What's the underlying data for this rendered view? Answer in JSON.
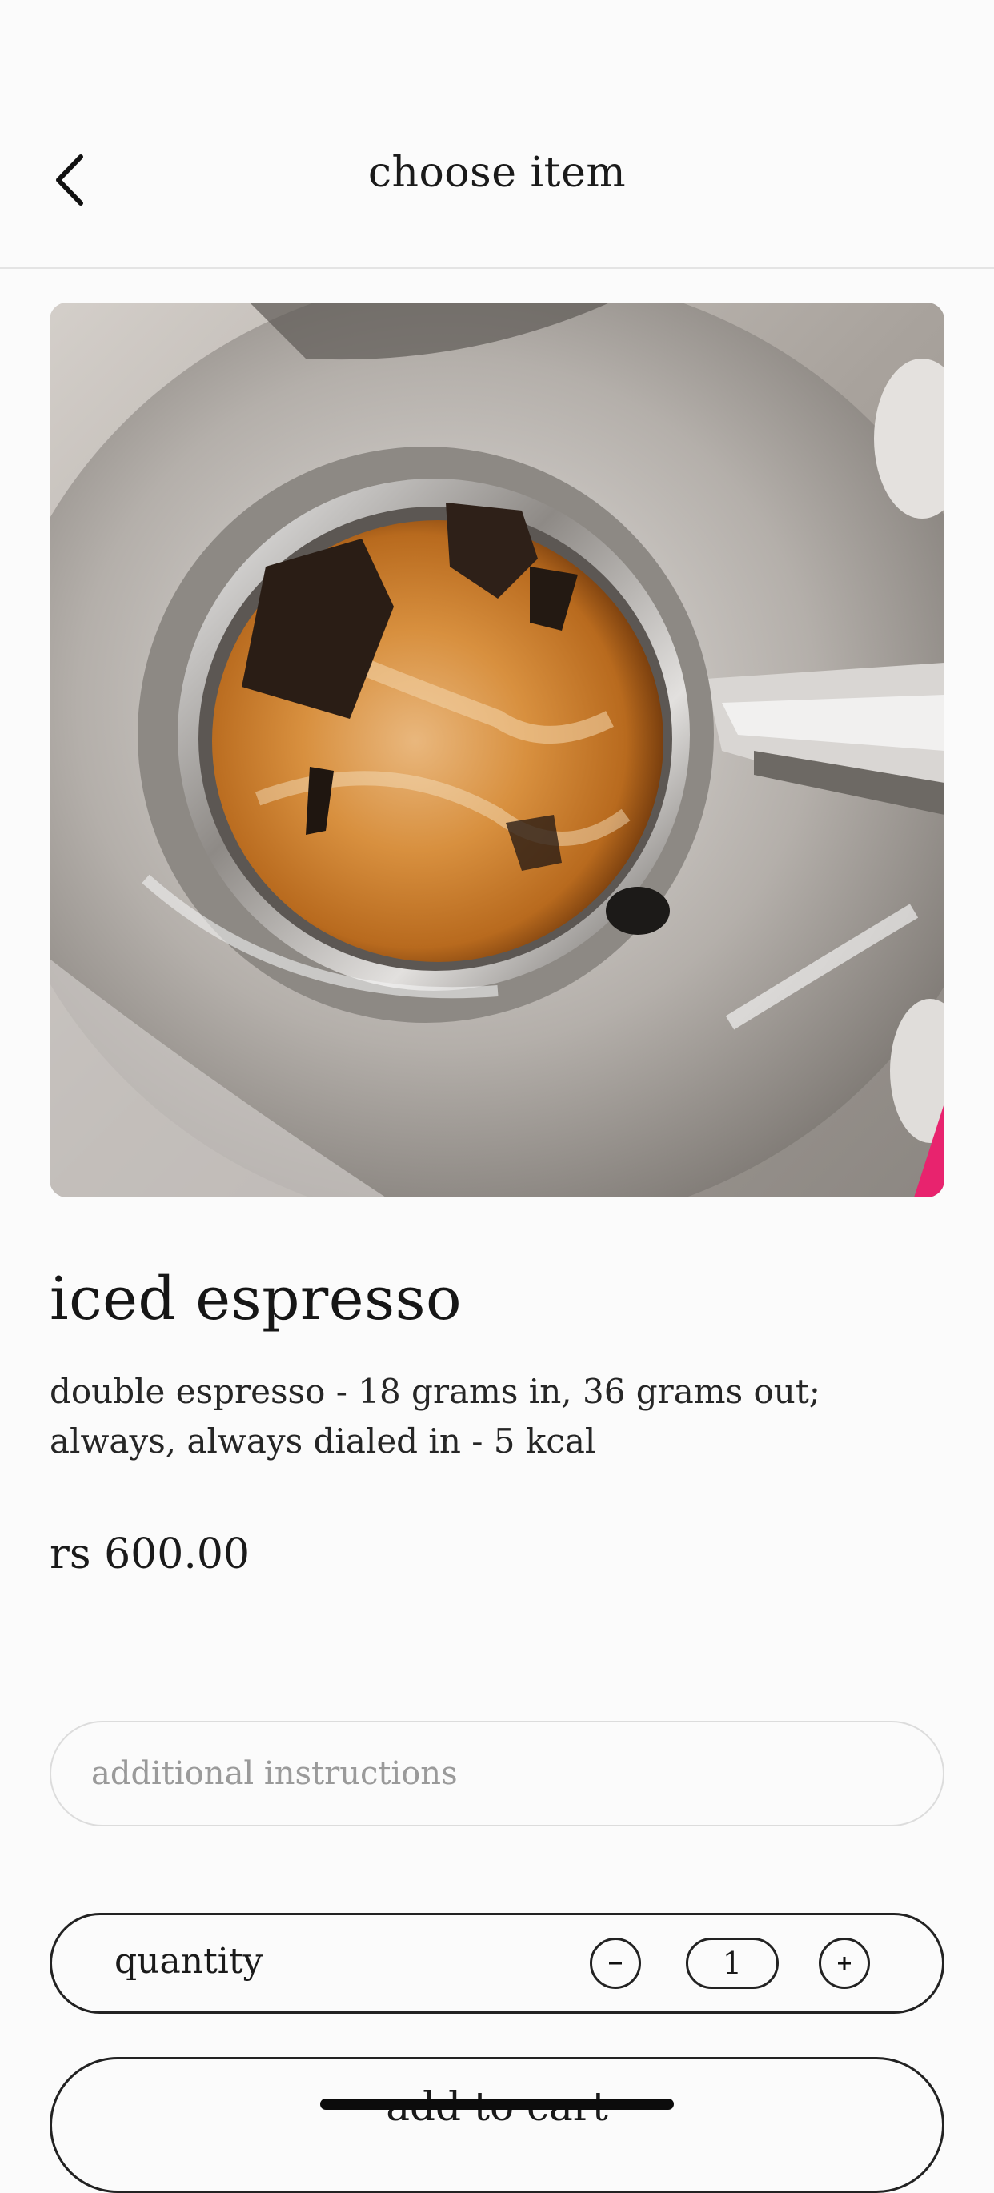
{
  "header": {
    "title": "choose item",
    "back_icon": "chevron-left-icon"
  },
  "product": {
    "image_alt": "iced espresso",
    "name": "iced espresso",
    "description": "double espresso - 18 grams in, 36 grams out; always, always dialed in - 5 kcal",
    "price": "rs 600.00"
  },
  "instructions": {
    "placeholder": "additional instructions",
    "value": ""
  },
  "quantity": {
    "label": "quantity",
    "value": "1",
    "decrement_icon": "minus-icon",
    "increment_icon": "plus-icon"
  },
  "cart": {
    "add_label": "add to cart"
  },
  "colors": {
    "background": "#fbfbfb",
    "text": "#141414",
    "divider": "#e4e4e4",
    "accent_pink": "#e8236e"
  }
}
